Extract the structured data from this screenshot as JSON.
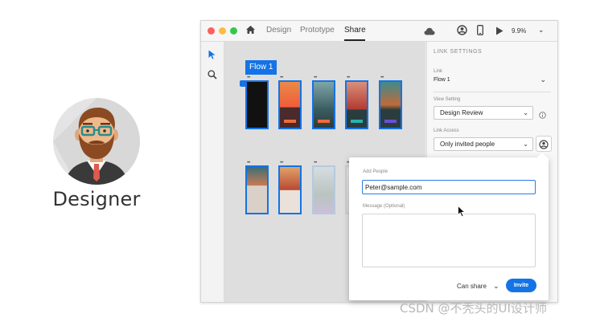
{
  "persona": {
    "label": "Designer"
  },
  "window": {
    "tabs": [
      {
        "label": "Design"
      },
      {
        "label": "Prototype"
      },
      {
        "label": "Share"
      }
    ],
    "zoom": "9.9%",
    "flow_label": "Flow 1"
  },
  "panel": {
    "title": "LINK SETTINGS",
    "link_label": "Link",
    "link_value": "Flow 1",
    "view_setting_label": "View Setting",
    "view_setting_value": "Design Review",
    "link_access_label": "Link Access",
    "link_access_value": "Only invited people"
  },
  "popover": {
    "add_people_label": "Add People",
    "email_value": "Peter@sample.com",
    "message_label": "Message (Optional)",
    "can_share_label": "Can share",
    "invite_label": "Invite"
  },
  "watermark": "CSDN @不秃头的UI设计师",
  "colors": {
    "accent": "#1473e6",
    "close": "#fc605c",
    "minimize": "#fdbc40",
    "zoom": "#34c84a"
  }
}
